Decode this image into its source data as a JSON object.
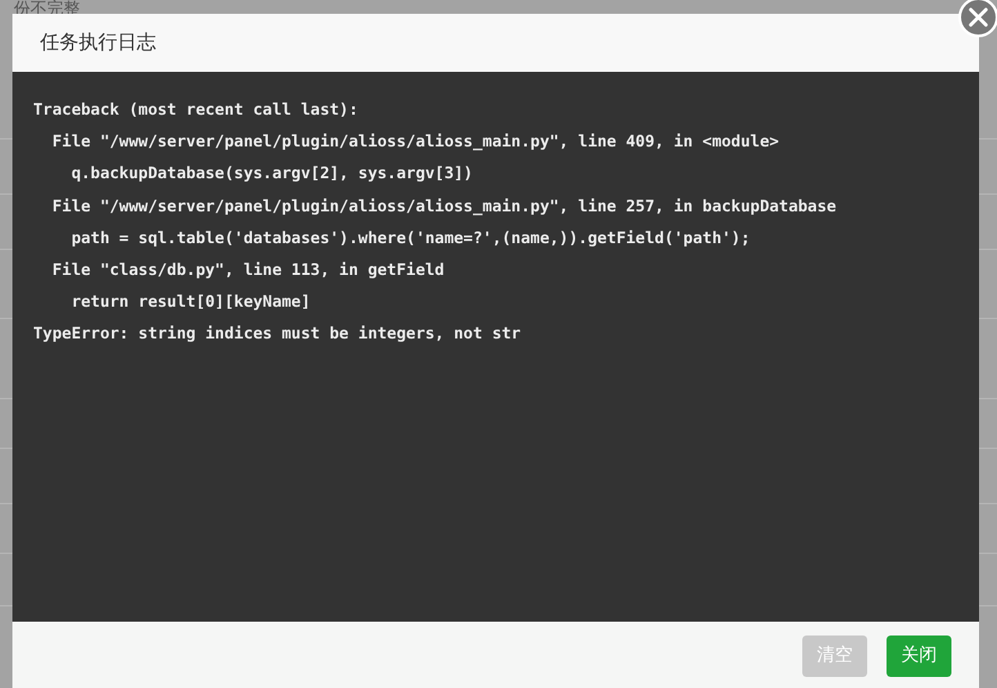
{
  "background": {
    "text": "份不完整"
  },
  "dialog": {
    "title": "任务执行日志",
    "log_lines": [
      "Traceback (most recent call last):",
      "  File \"/www/server/panel/plugin/alioss/alioss_main.py\", line 409, in <module>",
      "    q.backupDatabase(sys.argv[2], sys.argv[3])",
      "  File \"/www/server/panel/plugin/alioss/alioss_main.py\", line 257, in backupDatabase",
      "    path = sql.table('databases').where('name=?',(name,)).getField('path');",
      "  File \"class/db.py\", line 113, in getField",
      "    return result[0][keyName]",
      "TypeError: string indices must be integers, not str"
    ],
    "buttons": [
      {
        "label": "清空",
        "kind": "secondary"
      },
      {
        "label": "关闭",
        "kind": "primary"
      }
    ]
  }
}
